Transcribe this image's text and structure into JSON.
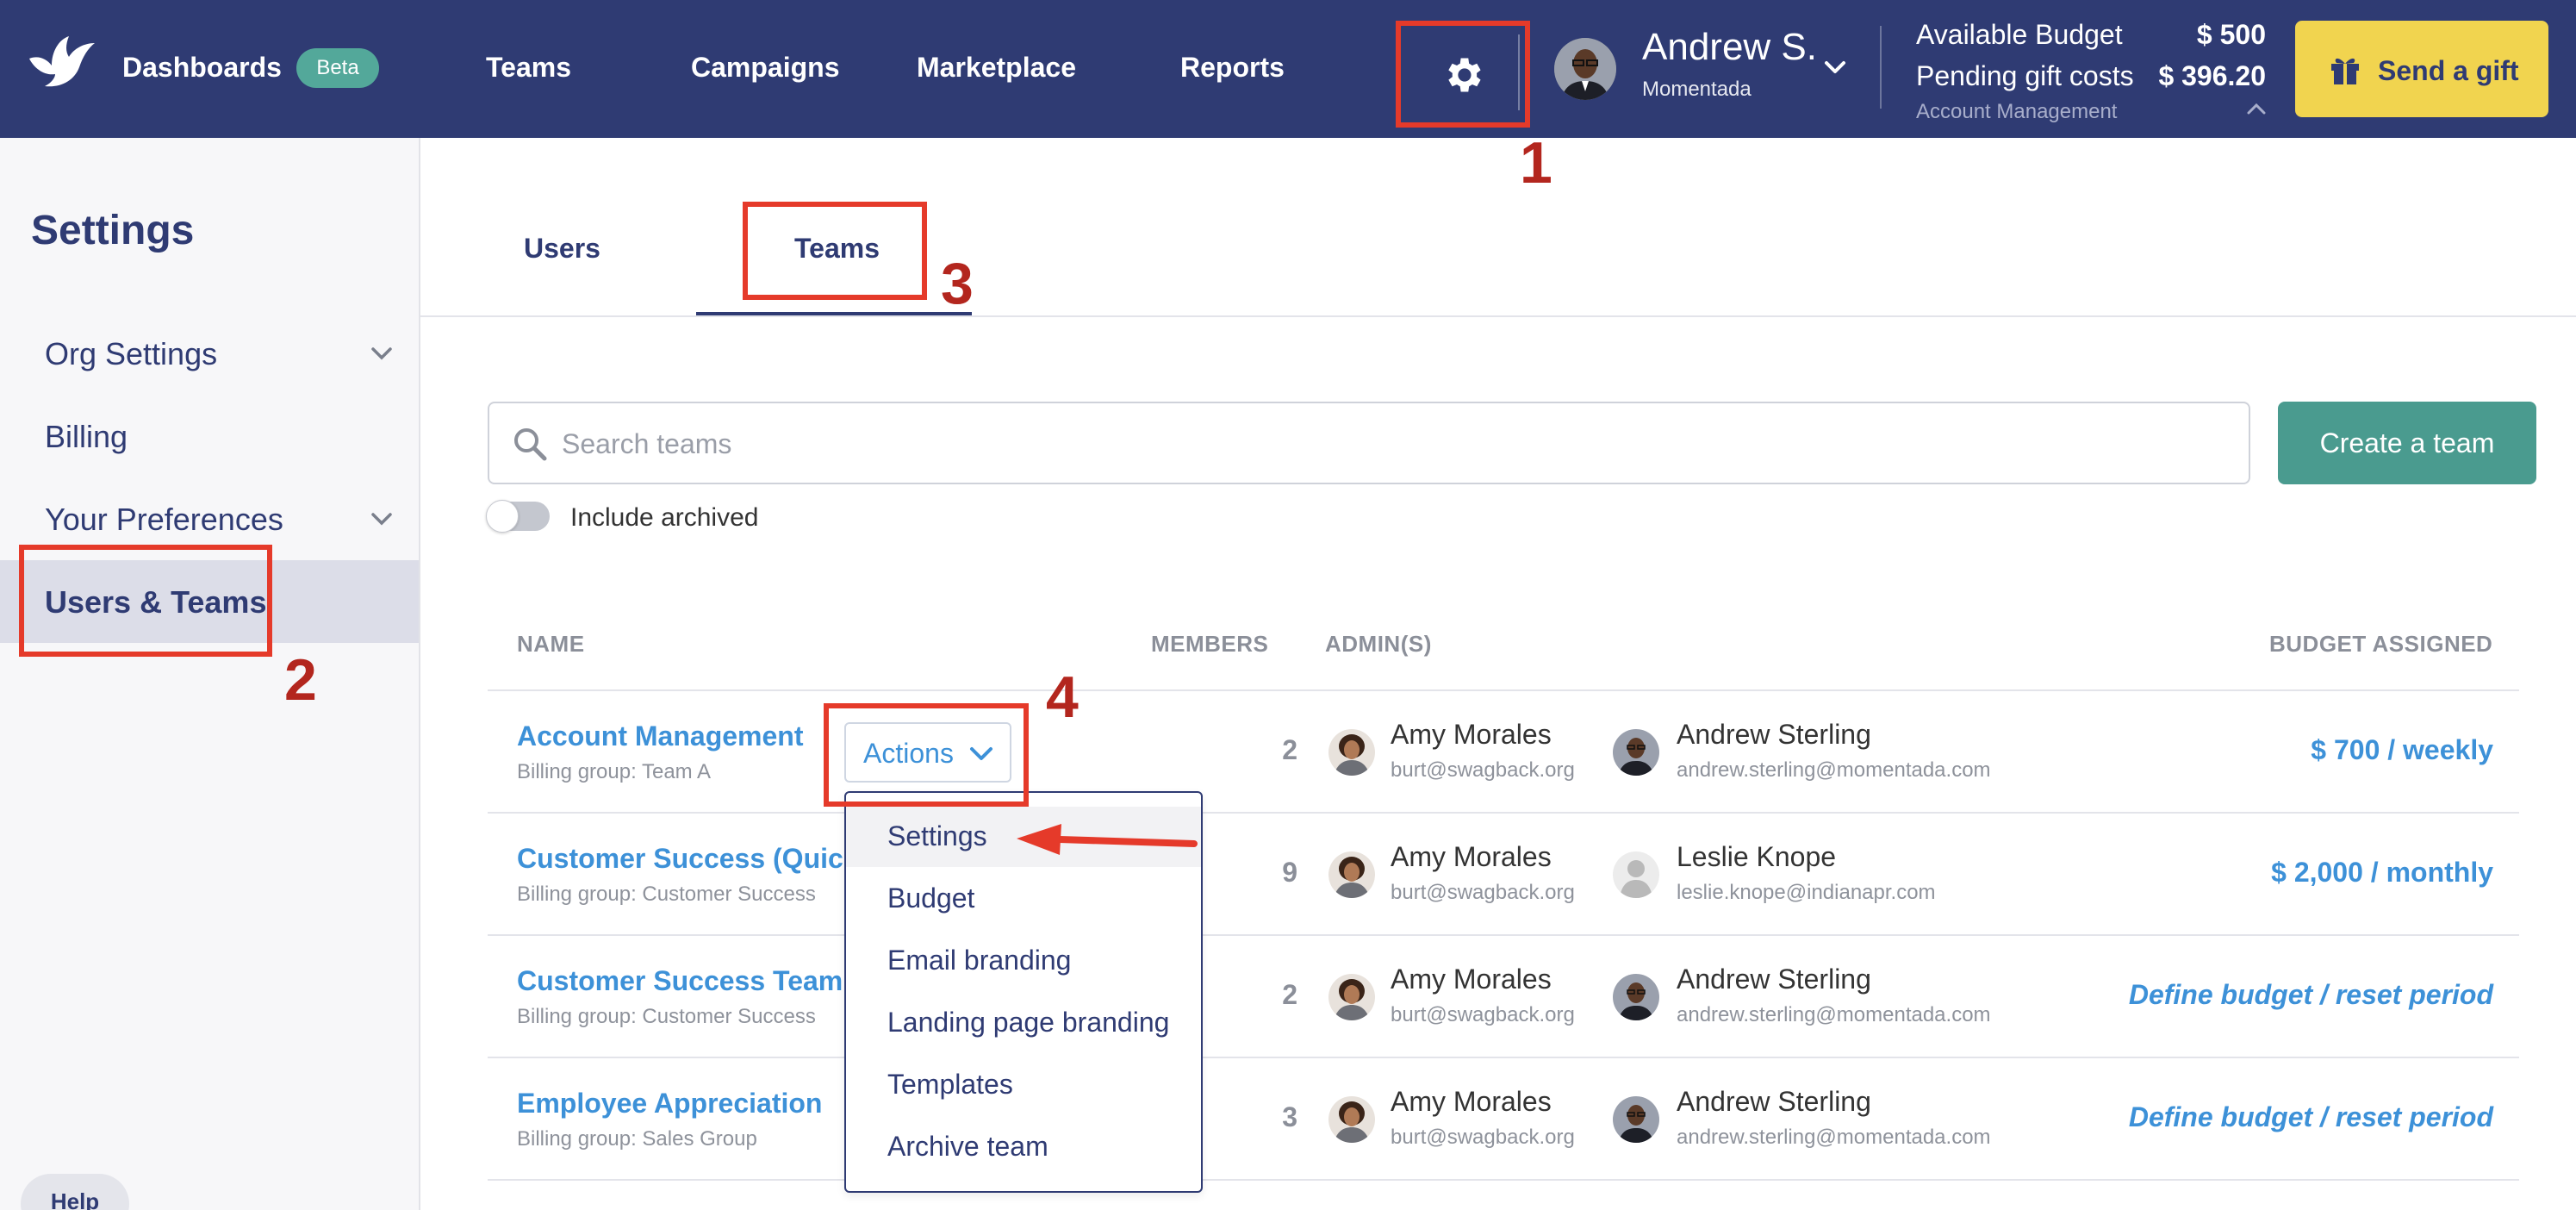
{
  "topnav": {
    "brand_label": "Dashboards",
    "beta_badge": "Beta",
    "links": [
      "Teams",
      "Campaigns",
      "Marketplace",
      "Reports"
    ],
    "user_name": "Andrew S.",
    "user_org": "Momentada",
    "available_budget_label": "Available Budget",
    "available_budget_value": "$ 500",
    "pending_costs_label": "Pending gift costs",
    "pending_costs_value": "$ 396.20",
    "account_label": "Account Management",
    "send_gift_label": "Send a gift",
    "bg_color": "#2f3b73",
    "gift_button_color": "#f1d44f"
  },
  "sidebar": {
    "title": "Settings",
    "items": [
      {
        "label": "Org Settings",
        "expandable": true
      },
      {
        "label": "Billing",
        "expandable": false
      },
      {
        "label": "Your Preferences",
        "expandable": true
      },
      {
        "label": "Users & Teams",
        "expandable": false,
        "active": true
      }
    ],
    "help_label": "Help"
  },
  "tabs": {
    "users_label": "Users",
    "teams_label": "Teams",
    "active": "Teams"
  },
  "search": {
    "placeholder": "Search teams",
    "value": ""
  },
  "create_team_label": "Create a team",
  "include_archived": {
    "label": "Include archived",
    "checked": false
  },
  "table": {
    "headers": {
      "name": "NAME",
      "members": "MEMBERS",
      "admins": "ADMIN(S)",
      "budget": "BUDGET ASSIGNED"
    },
    "rows": [
      {
        "name": "Account Management",
        "billing_group": "Billing group: Team A",
        "members": "2",
        "admin1_name": "Amy Morales",
        "admin1_email": "burt@swagback.org",
        "admin2_name": "Andrew Sterling",
        "admin2_email": "andrew.sterling@momentada.com",
        "budget": "$ 700 / weekly"
      },
      {
        "name": "Customer Success (QuickS",
        "billing_group": "Billing group: Customer Success",
        "members": "9",
        "admin1_name": "Amy Morales",
        "admin1_email": "burt@swagback.org",
        "admin2_name": "Leslie Knope",
        "admin2_email": "leslie.knope@indianapr.com",
        "budget": "$ 2,000 / monthly"
      },
      {
        "name": "Customer Success Team - E",
        "billing_group": "Billing group: Customer Success",
        "members": "2",
        "admin1_name": "Amy Morales",
        "admin1_email": "burt@swagback.org",
        "admin2_name": "Andrew Sterling",
        "admin2_email": "andrew.sterling@momentada.com",
        "budget": "Define budget / reset period"
      },
      {
        "name": "Employee Appreciation",
        "billing_group": "Billing group: Sales Group",
        "members": "3",
        "admin1_name": "Amy Morales",
        "admin1_email": "burt@swagback.org",
        "admin2_name": "Andrew Sterling",
        "admin2_email": "andrew.sterling@momentada.com",
        "budget": "Define budget / reset period"
      }
    ]
  },
  "actions_menu": {
    "button_label": "Actions",
    "items": [
      "Settings",
      "Budget",
      "Email branding",
      "Landing page branding",
      "Templates",
      "Archive team"
    ],
    "highlighted": "Settings"
  },
  "annotations": {
    "step1": "1",
    "step2": "2",
    "step3": "3",
    "step4": "4",
    "color": "#e53a2a"
  },
  "icons": [
    "bird-logo-icon",
    "gear-icon",
    "chevron-down-icon",
    "chevron-up-icon",
    "gift-icon",
    "search-icon",
    "arrow-left-icon"
  ]
}
